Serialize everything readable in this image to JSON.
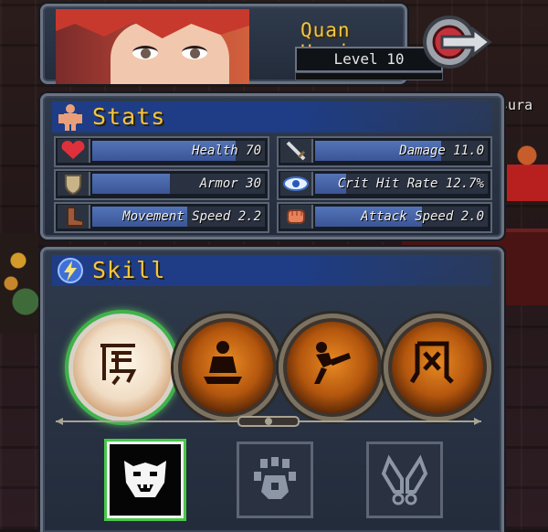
{
  "character": {
    "name": "Quan Huying",
    "level_label": "Level 10"
  },
  "npc": {
    "name": "Asura"
  },
  "stats": {
    "title": "Stats",
    "items": [
      {
        "label": "Health 70",
        "icon": "heart-icon",
        "fill": 0.83
      },
      {
        "label": "Damage 11.0",
        "icon": "sword-icon",
        "fill": 0.73
      },
      {
        "label": "Armor 30",
        "icon": "shield-icon",
        "fill": 0.45
      },
      {
        "label": "Crit Hit Rate 12.7%",
        "icon": "eye-icon",
        "fill": 0.18
      },
      {
        "label": "Movement Speed 2.2",
        "icon": "boot-icon",
        "fill": 0.55
      },
      {
        "label": "Attack Speed 2.0",
        "icon": "fist-icon",
        "fill": 0.62
      }
    ]
  },
  "skill": {
    "title": "Skill",
    "orbs": [
      {
        "icon": "tiger-kanji-icon",
        "active": true
      },
      {
        "icon": "meditating-figure-icon",
        "active": false
      },
      {
        "icon": "kicking-figure-icon",
        "active": false
      },
      {
        "icon": "phoenix-kanji-icon",
        "active": false
      }
    ],
    "styles": [
      {
        "icon": "tiger-face-icon",
        "active": true
      },
      {
        "icon": "paw-icon",
        "active": false
      },
      {
        "icon": "praying-hands-icon",
        "active": false
      }
    ]
  },
  "colors": {
    "accent_gold": "#f3c542",
    "header_blue": "#1e3d86",
    "active_green": "#49c64c"
  }
}
